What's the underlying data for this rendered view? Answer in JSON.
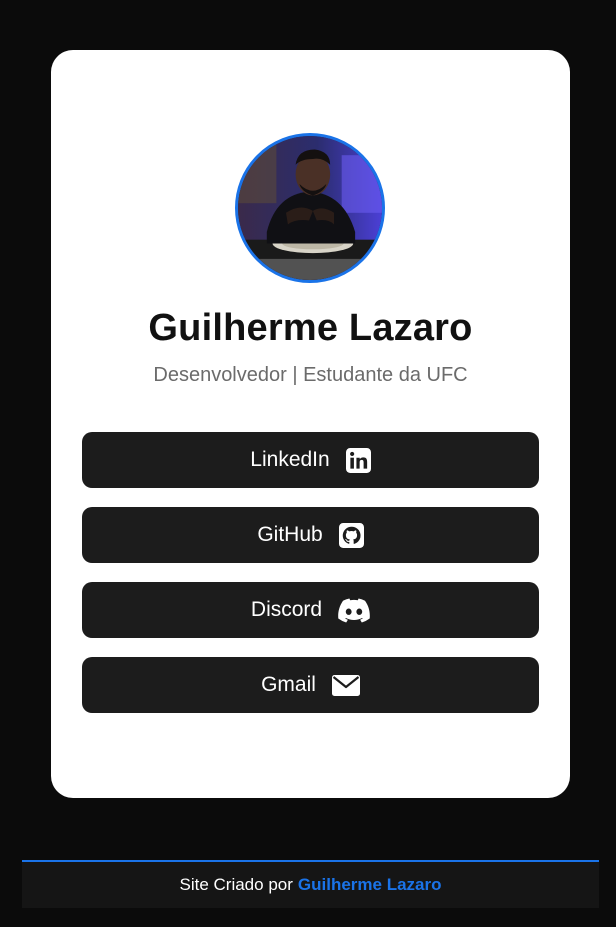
{
  "profile": {
    "name": "Guilherme Lazaro",
    "subtitle": "Desenvolvedor | Estudante da UFC",
    "avatar_alt": "Guilherme Lazaro"
  },
  "links": [
    {
      "label": "LinkedIn",
      "icon": "linkedin-icon"
    },
    {
      "label": "GitHub",
      "icon": "github-icon"
    },
    {
      "label": "Discord",
      "icon": "discord-icon"
    },
    {
      "label": "Gmail",
      "icon": "mail-icon"
    }
  ],
  "footer": {
    "prefix": "Site Criado por",
    "author": "Guilherme Lazaro"
  },
  "colors": {
    "page_background": "#0b0b0b",
    "card_background": "#ffffff",
    "button_background": "#1c1c1c",
    "accent": "#1a73e8"
  }
}
